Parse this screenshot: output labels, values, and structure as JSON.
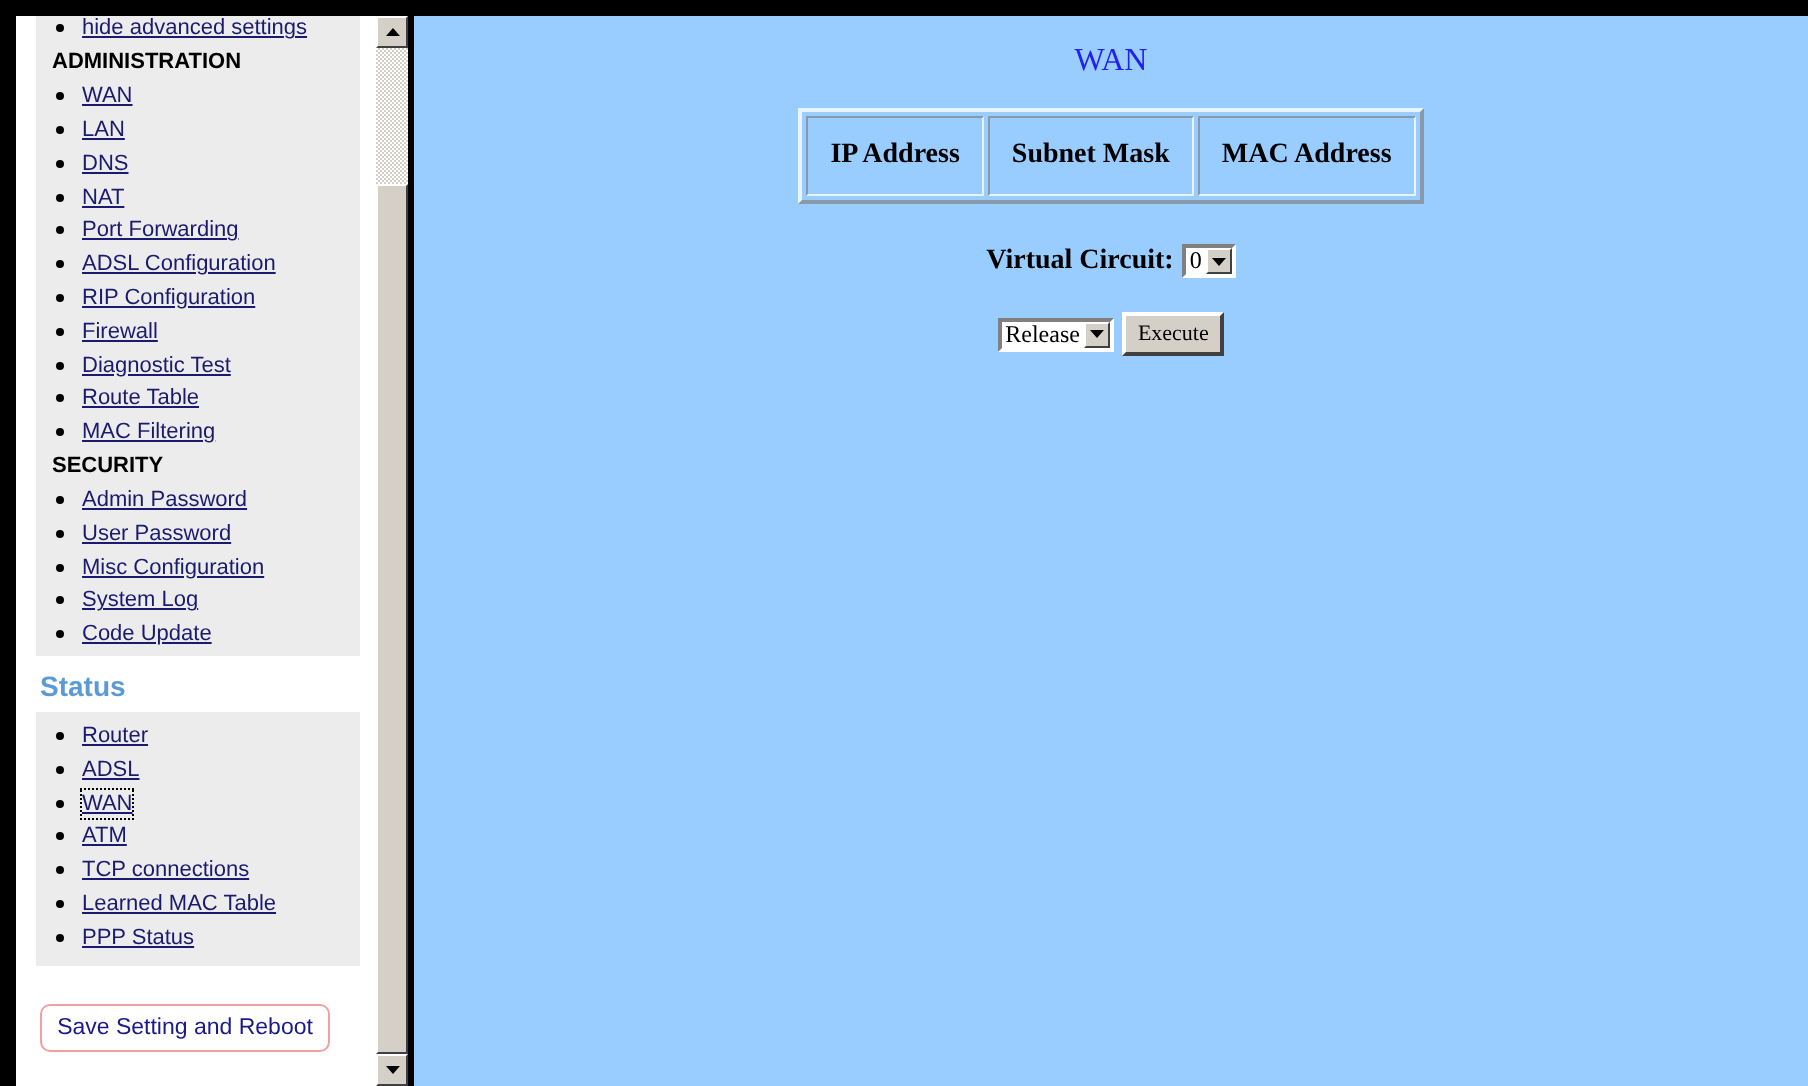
{
  "sidebar": {
    "top_link": "hide advanced settings",
    "sections": [
      {
        "heading": "ADMINISTRATION",
        "items": [
          "WAN",
          "LAN",
          "DNS",
          "NAT",
          "Port Forwarding",
          "ADSL Configuration",
          "RIP Configuration",
          "Firewall",
          "Diagnostic Test",
          "Route Table",
          "MAC Filtering"
        ]
      },
      {
        "heading": "SECURITY",
        "items": [
          "Admin Password",
          "User Password",
          "Misc Configuration",
          "System Log",
          "Code Update"
        ]
      }
    ],
    "status": {
      "heading": "Status",
      "items": [
        {
          "label": "Router",
          "selected": false
        },
        {
          "label": "ADSL",
          "selected": false
        },
        {
          "label": "WAN",
          "selected": true
        },
        {
          "label": "ATM",
          "selected": false
        },
        {
          "label": "TCP connections",
          "selected": false
        },
        {
          "label": "Learned MAC Table",
          "selected": false
        },
        {
          "label": "PPP Status",
          "selected": false
        }
      ]
    },
    "save_button": "Save Setting and Reboot"
  },
  "main": {
    "title": "WAN",
    "table": {
      "columns": [
        "IP Address",
        "Subnet Mask",
        "MAC Address"
      ]
    },
    "virtual_circuit": {
      "label": "Virtual Circuit:",
      "value": "0"
    },
    "action": {
      "value": "Release",
      "button": "Execute"
    }
  }
}
